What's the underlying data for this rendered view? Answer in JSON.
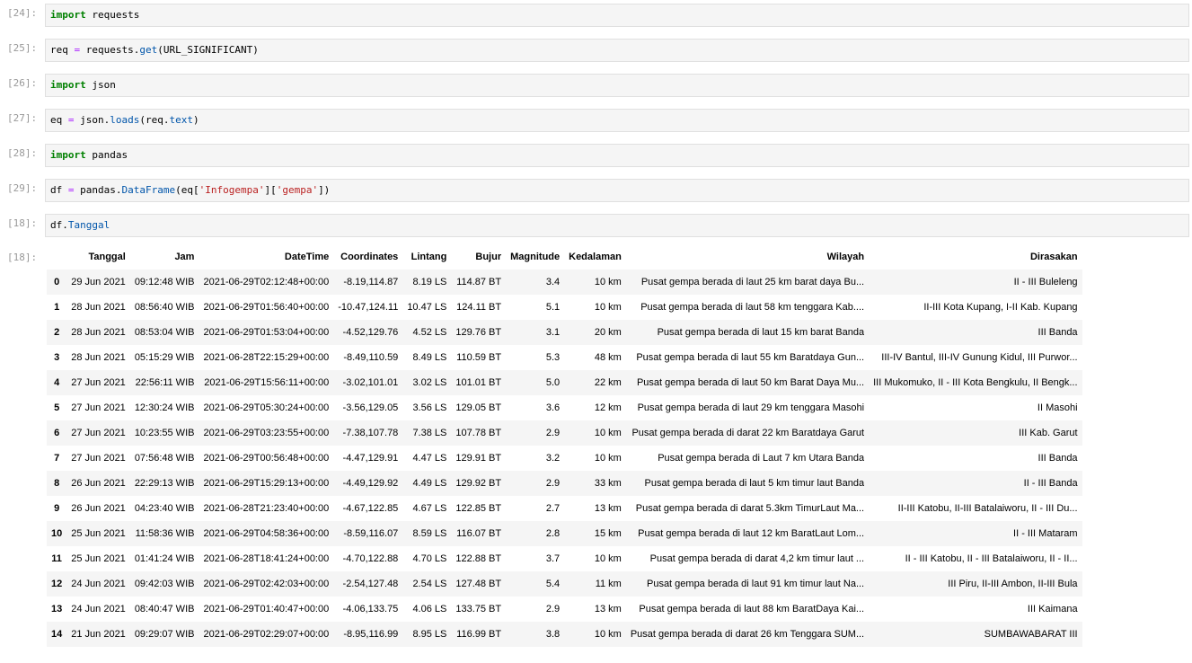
{
  "cells": [
    {
      "prompt": "[24]:",
      "tokens": [
        {
          "t": "import",
          "c": "kw"
        },
        {
          "t": " requests",
          "c": ""
        }
      ]
    },
    {
      "prompt": "[25]:",
      "tokens": [
        {
          "t": "req ",
          "c": ""
        },
        {
          "t": "=",
          "c": "op"
        },
        {
          "t": " requests.",
          "c": ""
        },
        {
          "t": "get",
          "c": "fn"
        },
        {
          "t": "(URL_SIGNIFICANT)",
          "c": ""
        }
      ]
    },
    {
      "prompt": "[26]:",
      "tokens": [
        {
          "t": "import",
          "c": "kw"
        },
        {
          "t": " json",
          "c": ""
        }
      ]
    },
    {
      "prompt": "[27]:",
      "tokens": [
        {
          "t": "eq ",
          "c": ""
        },
        {
          "t": "=",
          "c": "op"
        },
        {
          "t": " json.",
          "c": ""
        },
        {
          "t": "loads",
          "c": "fn"
        },
        {
          "t": "(req.",
          "c": ""
        },
        {
          "t": "text",
          "c": "fn"
        },
        {
          "t": ")",
          "c": ""
        }
      ]
    },
    {
      "prompt": "[28]:",
      "tokens": [
        {
          "t": "import",
          "c": "kw"
        },
        {
          "t": " pandas",
          "c": ""
        }
      ]
    },
    {
      "prompt": "[29]:",
      "tokens": [
        {
          "t": "df ",
          "c": ""
        },
        {
          "t": "=",
          "c": "op"
        },
        {
          "t": " pandas.",
          "c": ""
        },
        {
          "t": "DataFrame",
          "c": "fn"
        },
        {
          "t": "(eq[",
          "c": ""
        },
        {
          "t": "'Infogempa'",
          "c": "str"
        },
        {
          "t": "][",
          "c": ""
        },
        {
          "t": "'gempa'",
          "c": "str"
        },
        {
          "t": "])",
          "c": ""
        }
      ]
    },
    {
      "prompt": "[18]:",
      "tokens": [
        {
          "t": "df.",
          "c": ""
        },
        {
          "t": "Tanggal",
          "c": "fn"
        }
      ]
    }
  ],
  "output_prompt": "[18]:",
  "table": {
    "columns": [
      "",
      "Tanggal",
      "Jam",
      "DateTime",
      "Coordinates",
      "Lintang",
      "Bujur",
      "Magnitude",
      "Kedalaman",
      "Wilayah",
      "Dirasakan"
    ],
    "rows": [
      [
        "0",
        "29 Jun 2021",
        "09:12:48 WIB",
        "2021-06-29T02:12:48+00:00",
        "-8.19,114.87",
        "8.19 LS",
        "114.87 BT",
        "3.4",
        "10 km",
        "Pusat gempa berada di laut 25 km barat daya Bu...",
        "II - III Buleleng"
      ],
      [
        "1",
        "28 Jun 2021",
        "08:56:40 WIB",
        "2021-06-29T01:56:40+00:00",
        "-10.47,124.11",
        "10.47 LS",
        "124.11 BT",
        "5.1",
        "10 km",
        "Pusat gempa berada di laut 58 km tenggara Kab....",
        "II-III Kota Kupang, I-II Kab. Kupang"
      ],
      [
        "2",
        "28 Jun 2021",
        "08:53:04 WIB",
        "2021-06-29T01:53:04+00:00",
        "-4.52,129.76",
        "4.52 LS",
        "129.76 BT",
        "3.1",
        "20 km",
        "Pusat gempa berada di laut 15 km barat Banda",
        "III Banda"
      ],
      [
        "3",
        "28 Jun 2021",
        "05:15:29 WIB",
        "2021-06-28T22:15:29+00:00",
        "-8.49,110.59",
        "8.49 LS",
        "110.59 BT",
        "5.3",
        "48 km",
        "Pusat gempa berada di laut 55 km Baratdaya Gun...",
        "III-IV Bantul, III-IV Gunung Kidul, III Purwor..."
      ],
      [
        "4",
        "27 Jun 2021",
        "22:56:11 WIB",
        "2021-06-29T15:56:11+00:00",
        "-3.02,101.01",
        "3.02 LS",
        "101.01 BT",
        "5.0",
        "22 km",
        "Pusat gempa berada di laut 50 km Barat Daya Mu...",
        "III Mukomuko, II - III Kota Bengkulu, II Bengk..."
      ],
      [
        "5",
        "27 Jun 2021",
        "12:30:24 WIB",
        "2021-06-29T05:30:24+00:00",
        "-3.56,129.05",
        "3.56 LS",
        "129.05 BT",
        "3.6",
        "12 km",
        "Pusat gempa berada di laut 29 km tenggara Masohi",
        "II Masohi"
      ],
      [
        "6",
        "27 Jun 2021",
        "10:23:55 WIB",
        "2021-06-29T03:23:55+00:00",
        "-7.38,107.78",
        "7.38 LS",
        "107.78 BT",
        "2.9",
        "10 km",
        "Pusat gempa berada di darat 22 km Baratdaya Garut",
        "III Kab. Garut"
      ],
      [
        "7",
        "27 Jun 2021",
        "07:56:48 WIB",
        "2021-06-29T00:56:48+00:00",
        "-4.47,129.91",
        "4.47 LS",
        "129.91 BT",
        "3.2",
        "10 km",
        "Pusat gempa berada di Laut 7 km Utara Banda",
        "III Banda"
      ],
      [
        "8",
        "26 Jun 2021",
        "22:29:13 WIB",
        "2021-06-29T15:29:13+00:00",
        "-4.49,129.92",
        "4.49 LS",
        "129.92 BT",
        "2.9",
        "33 km",
        "Pusat gempa berada di laut 5 km timur laut Banda",
        "II - III Banda"
      ],
      [
        "9",
        "26 Jun 2021",
        "04:23:40 WIB",
        "2021-06-28T21:23:40+00:00",
        "-4.67,122.85",
        "4.67 LS",
        "122.85 BT",
        "2.7",
        "13 km",
        "Pusat gempa berada di darat 5.3km TimurLaut Ma...",
        "II-III Katobu, II-III Batalaiworu, II - III Du..."
      ],
      [
        "10",
        "25 Jun 2021",
        "11:58:36 WIB",
        "2021-06-29T04:58:36+00:00",
        "-8.59,116.07",
        "8.59 LS",
        "116.07 BT",
        "2.8",
        "15 km",
        "Pusat gempa berada di laut 12 km BaratLaut Lom...",
        "II - III Mataram"
      ],
      [
        "11",
        "25 Jun 2021",
        "01:41:24 WIB",
        "2021-06-28T18:41:24+00:00",
        "-4.70,122.88",
        "4.70 LS",
        "122.88 BT",
        "3.7",
        "10 km",
        "Pusat gempa berada di darat 4,2 km timur laut ...",
        "II - III Katobu, II - III Batalaiworu, II - II..."
      ],
      [
        "12",
        "24 Jun 2021",
        "09:42:03 WIB",
        "2021-06-29T02:42:03+00:00",
        "-2.54,127.48",
        "2.54 LS",
        "127.48 BT",
        "5.4",
        "11 km",
        "Pusat gempa berada di laut 91 km timur laut Na...",
        "III Piru, II-III Ambon, II-III Bula"
      ],
      [
        "13",
        "24 Jun 2021",
        "08:40:47 WIB",
        "2021-06-29T01:40:47+00:00",
        "-4.06,133.75",
        "4.06 LS",
        "133.75 BT",
        "2.9",
        "13 km",
        "Pusat gempa berada di laut 88 km BaratDaya Kai...",
        "III Kaimana"
      ],
      [
        "14",
        "21 Jun 2021",
        "09:29:07 WIB",
        "2021-06-29T02:29:07+00:00",
        "-8.95,116.99",
        "8.95 LS",
        "116.99 BT",
        "3.8",
        "10 km",
        "Pusat gempa berada di darat 26 km Tenggara SUM...",
        "SUMBAWABARAT III"
      ]
    ]
  }
}
